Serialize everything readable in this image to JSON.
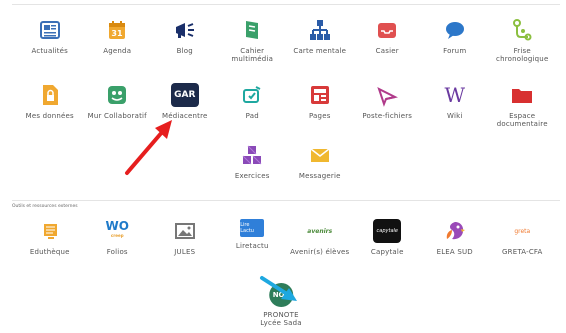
{
  "section_title": "Outils et ressources externes",
  "row1": [
    {
      "label": "Actualités",
      "icon": "newspaper-icon",
      "color": "#3b6fb6"
    },
    {
      "label": "Agenda",
      "icon": "calendar-icon",
      "color": "#f0a830"
    },
    {
      "label": "Blog",
      "icon": "megaphone-icon",
      "color": "#1a2f6a"
    },
    {
      "label": "Cahier multimédia",
      "icon": "notebook-icon",
      "color": "#3aa06a"
    },
    {
      "label": "Carte mentale",
      "icon": "mindmap-icon",
      "color": "#2a5ca8"
    },
    {
      "label": "Casier",
      "icon": "inbox-icon",
      "color": "#e05050"
    },
    {
      "label": "Forum",
      "icon": "chat-icon",
      "color": "#2c77c9"
    },
    {
      "label": "Frise chronologique",
      "icon": "timeline-icon",
      "color": "#8bbf3f"
    }
  ],
  "row2": [
    {
      "label": "Mes données",
      "icon": "file-lock-icon",
      "color": "#f0a830"
    },
    {
      "label": "Mur Collaboratif",
      "icon": "wall-icon",
      "color": "#3aa06a"
    },
    {
      "label": "Médiacentre",
      "icon": "gar-icon",
      "text": "GAR",
      "color": "#1c2a4a"
    },
    {
      "label": "Pad",
      "icon": "pad-icon",
      "color": "#1fa8a0"
    },
    {
      "label": "Pages",
      "icon": "pages-icon",
      "color": "#d83a3a"
    },
    {
      "label": "Poste-fichiers",
      "icon": "paper-plane-icon",
      "color": "#b03a8a"
    },
    {
      "label": "Wiki",
      "icon": "wiki-icon",
      "text": "W",
      "color": "#6a3aa0"
    },
    {
      "label": "Espace documentaire",
      "icon": "folder-icon",
      "color": "#d83030"
    }
  ],
  "row3": [
    {
      "label": "Exercices",
      "icon": "cubes-icon",
      "color": "#8a4ab8"
    },
    {
      "label": "Messagerie",
      "icon": "envelope-icon",
      "color": "#f0b830"
    }
  ],
  "row4": [
    {
      "label": "Eduthèque",
      "icon": "edutheque-icon",
      "color": "#f0a830"
    },
    {
      "label": "Folios",
      "icon": "folios-icon",
      "text": "WO",
      "color": "#1f7ac9"
    },
    {
      "label": "JULES",
      "icon": "image-icon",
      "color": "#777777"
    },
    {
      "label": "Liretactu",
      "icon": "liretactu-icon",
      "text": "Lire Lactu",
      "color": "#2f7fd9"
    },
    {
      "label": "Avenir(s) élèves",
      "icon": "avenirs-icon",
      "text": "avenirs",
      "color": "#4b8a3a"
    },
    {
      "label": "Capytale",
      "icon": "capytale-icon",
      "text": "capytale",
      "color": "#111111"
    },
    {
      "label": "ELEA SUD",
      "icon": "parrot-icon",
      "color": "#9a4ab8"
    },
    {
      "label": "GRETA-CFA",
      "icon": "greta-icon",
      "text": "greta",
      "color": "#f07a30"
    }
  ],
  "extra": {
    "label_line1": "PRONOTE",
    "label_line2": "Lycée Sada",
    "text": "NOT",
    "icon": "pronote-icon",
    "color": "#2e7d5a"
  },
  "annotations": {
    "red_arrow_color": "#e61e1e",
    "blue_arrow_color": "#1ea8e0"
  }
}
